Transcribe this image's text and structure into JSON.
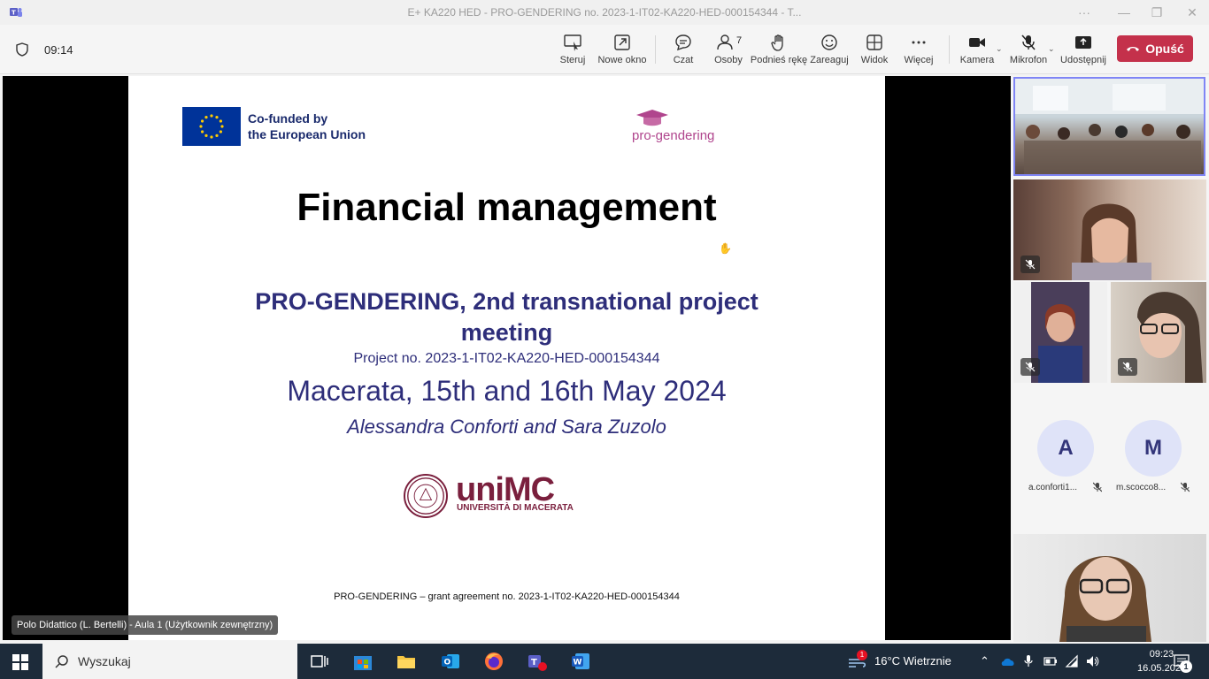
{
  "window": {
    "title": "E+ KA220 HED - PRO-GENDERING no. 2023-1-IT02-KA220-HED-000154344 - T...",
    "controls": [
      "···",
      "—",
      "❐",
      "✕"
    ]
  },
  "meeting": {
    "timer": "09:14",
    "toolbar": {
      "steruj": "Steruj",
      "nowe_okno": "Nowe okno",
      "czat": "Czat",
      "osoby": "Osoby",
      "osoby_count": "7",
      "podnies": "Podnieś rękę",
      "zareaguj": "Zareaguj",
      "widok": "Widok",
      "wiecej": "Więcej",
      "kamera": "Kamera",
      "mikrofon": "Mikrofon",
      "udostepnij": "Udostępnij",
      "opusc": "Opuść"
    },
    "presenter_label": "Polo Didattico (L. Bertelli) - Aula 1 (Użytkownik zewnętrzny)"
  },
  "slide": {
    "eu_line1": "Co-funded by",
    "eu_line2": "the European Union",
    "pg_logo": "pro-gendering",
    "title": "Financial management",
    "subtitle": "PRO-GENDERING, 2nd transnational project meeting",
    "project": "Project no. 2023-1-IT02-KA220-HED-000154344",
    "place": "Macerata, 15th and 16th May 2024",
    "authors": "Alessandra Conforti and Sara Zuzolo",
    "unimc": "uniMC",
    "unimc_sub": "UNIVERSITÀ DI MACERATA",
    "footer": "PRO-GENDERING – grant agreement no. 2023-1-IT02-KA220-HED-000154344"
  },
  "participants": [
    {
      "initial": "A",
      "name": "a.conforti1..."
    },
    {
      "initial": "M",
      "name": "m.scocco8..."
    }
  ],
  "taskbar": {
    "search": "Wyszukaj",
    "weather": "16°C  Wietrznie",
    "weather_badge": "1",
    "time": "09:23",
    "date": "16.05.2024",
    "notifications": "1"
  },
  "colors": {
    "teams_purple": "#5b5fc7",
    "leave_red": "#c4314b",
    "slide_blue": "#2e2e7a",
    "unimc_maroon": "#7a1f3d",
    "eu_blue": "#003399"
  }
}
